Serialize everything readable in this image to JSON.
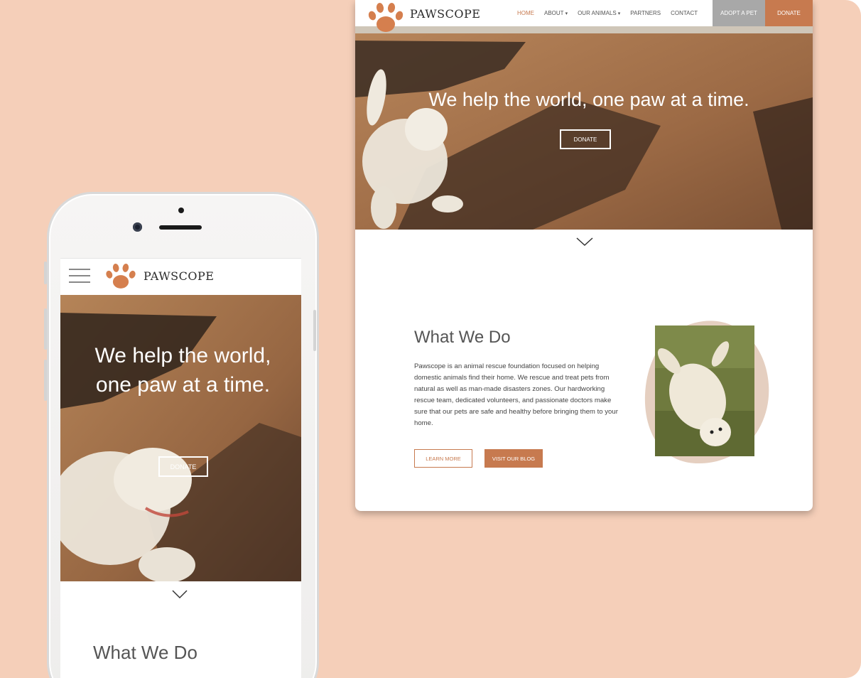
{
  "colors": {
    "background": "#f5cfb9",
    "accent": "#c77a4f",
    "adopt_bg": "#a8a8a8",
    "text_dark": "#555555"
  },
  "desktop": {
    "brand": "PAWSCOPE",
    "logo_icon": "paw-icon",
    "nav": {
      "home": "HOME",
      "about": "ABOUT",
      "our_animals": "OUR ANIMALS",
      "partners": "PARTNERS",
      "contact": "CONTACT",
      "adopt": "ADOPT A PET",
      "donate": "DONATE"
    },
    "hero": {
      "title": "We help the world, one paw at a time.",
      "button": "DONATE"
    },
    "scroll_icon": "chevron-down-icon",
    "what_we_do": {
      "title": "What We Do",
      "body": "Pawscope is an animal rescue foundation focused on helping domestic animals find their home. We rescue and treat pets from natural as well as man-made disasters zones. Our hardworking rescue team, dedicated volunteers, and passionate doctors make sure that our pets are safe and healthy before bringing them to your home.",
      "learn_more": "LEARN MORE",
      "visit_blog": "VISIT OUR BLOG"
    }
  },
  "mobile": {
    "brand": "PAWSCOPE",
    "menu_icon": "hamburger-icon",
    "hero": {
      "title": "We help the world, one paw at a time.",
      "button": "DONATE"
    },
    "what_we_do_title": "What We Do"
  }
}
